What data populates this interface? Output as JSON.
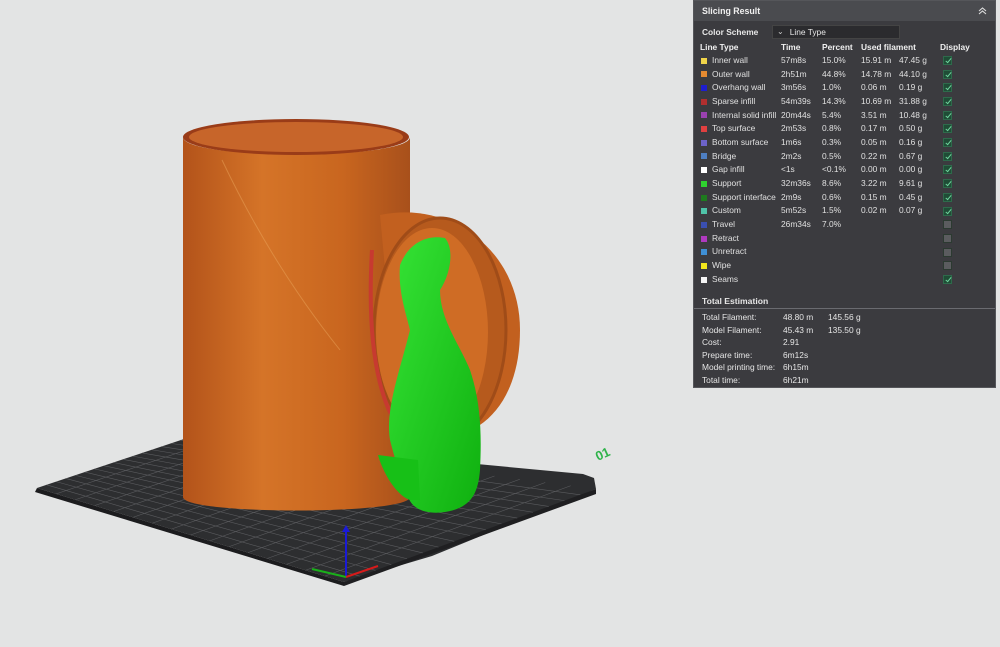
{
  "panel": {
    "title": "Slicing Result",
    "color_scheme_label": "Color Scheme",
    "color_scheme_value": "Line Type",
    "headers": {
      "line_type": "Line Type",
      "time": "Time",
      "percent": "Percent",
      "used_filament": "Used filament",
      "display": "Display"
    },
    "rows": [
      {
        "name": "Inner wall",
        "color": "#f0d54a",
        "time": "57m8s",
        "percent": "15.0%",
        "length": "15.91 m",
        "weight": "47.45 g",
        "display": true
      },
      {
        "name": "Outer wall",
        "color": "#e58a31",
        "time": "2h51m",
        "percent": "44.8%",
        "length": "14.78 m",
        "weight": "44.10 g",
        "display": true
      },
      {
        "name": "Overhang wall",
        "color": "#1e1ecf",
        "time": "3m56s",
        "percent": "1.0%",
        "length": "0.06 m",
        "weight": "0.19 g",
        "display": true
      },
      {
        "name": "Sparse infill",
        "color": "#b12f2f",
        "time": "54m39s",
        "percent": "14.3%",
        "length": "10.69 m",
        "weight": "31.88 g",
        "display": true
      },
      {
        "name": "Internal solid infill",
        "color": "#9b41b0",
        "time": "20m44s",
        "percent": "5.4%",
        "length": "3.51 m",
        "weight": "10.48 g",
        "display": true
      },
      {
        "name": "Top surface",
        "color": "#e04040",
        "time": "2m53s",
        "percent": "0.8%",
        "length": "0.17 m",
        "weight": "0.50 g",
        "display": true
      },
      {
        "name": "Bottom surface",
        "color": "#6d63c9",
        "time": "1m6s",
        "percent": "0.3%",
        "length": "0.05 m",
        "weight": "0.16 g",
        "display": true
      },
      {
        "name": "Bridge",
        "color": "#4e7fc3",
        "time": "2m2s",
        "percent": "0.5%",
        "length": "0.22 m",
        "weight": "0.67 g",
        "display": true
      },
      {
        "name": "Gap infill",
        "color": "#ffffff",
        "time": "<1s",
        "percent": "<0.1%",
        "length": "0.00 m",
        "weight": "0.00 g",
        "display": true
      },
      {
        "name": "Support",
        "color": "#2fd12f",
        "time": "32m36s",
        "percent": "8.6%",
        "length": "3.22 m",
        "weight": "9.61 g",
        "display": true
      },
      {
        "name": "Support interface",
        "color": "#1e7a1e",
        "time": "2m9s",
        "percent": "0.6%",
        "length": "0.15 m",
        "weight": "0.45 g",
        "display": true
      },
      {
        "name": "Custom",
        "color": "#4fc3a8",
        "time": "5m52s",
        "percent": "1.5%",
        "length": "0.02 m",
        "weight": "0.07 g",
        "display": true
      },
      {
        "name": "Travel",
        "color": "#3a4fb0",
        "time": "26m34s",
        "percent": "7.0%",
        "length": "",
        "weight": "",
        "display": false
      },
      {
        "name": "Retract",
        "color": "#b03ac0",
        "time": "",
        "percent": "",
        "length": "",
        "weight": "",
        "display": false
      },
      {
        "name": "Unretract",
        "color": "#3f8fd4",
        "time": "",
        "percent": "",
        "length": "",
        "weight": "",
        "display": false
      },
      {
        "name": "Wipe",
        "color": "#f2e61d",
        "time": "",
        "percent": "",
        "length": "",
        "weight": "",
        "display": false
      },
      {
        "name": "Seams",
        "color": "#f4f4f4",
        "time": "",
        "percent": "",
        "length": "",
        "weight": "",
        "display": true
      }
    ],
    "total_title": "Total Estimation",
    "estimation": [
      {
        "label": "Total Filament:",
        "value1": "48.80 m",
        "value2": "145.56 g"
      },
      {
        "label": "Model Filament:",
        "value1": "45.43 m",
        "value2": "135.50 g"
      },
      {
        "label": "Cost:",
        "value1": "2.91",
        "value2": ""
      },
      {
        "label": "Prepare time:",
        "value1": "6m12s",
        "value2": ""
      },
      {
        "label": "Model printing time:",
        "value1": "6h15m",
        "value2": ""
      },
      {
        "label": "Total time:",
        "value1": "6h21m",
        "value2": ""
      }
    ]
  },
  "scene": {
    "plate_number": "01",
    "model_color": "#c9661f",
    "support_color": "#16d416",
    "plate_color": "#2b2c2e"
  }
}
